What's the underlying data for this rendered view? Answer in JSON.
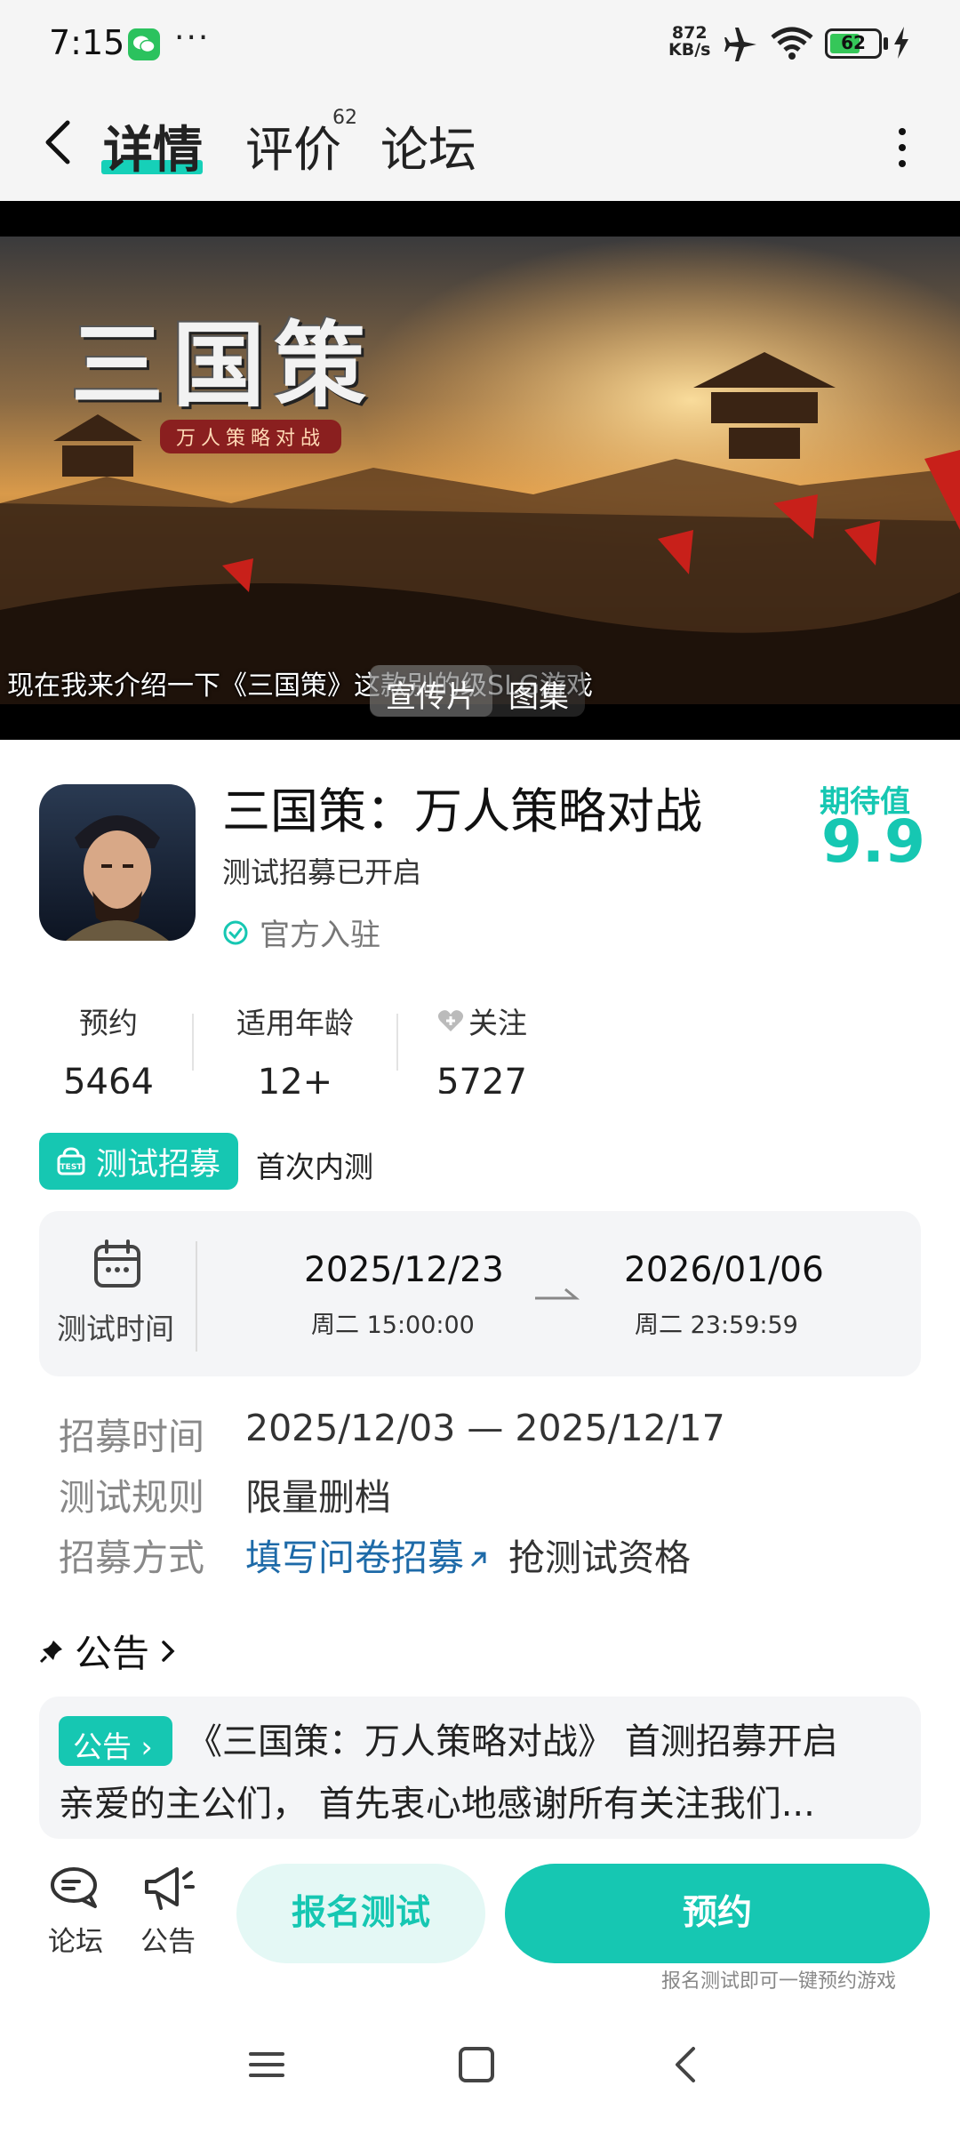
{
  "status_bar": {
    "time": "7:15",
    "net_speed_value": "872",
    "net_speed_unit": "KB/s",
    "battery": "62",
    "icons": [
      "wechat-icon",
      "more-dots-icon",
      "airplane-icon",
      "wifi-icon",
      "battery-icon",
      "charging-icon"
    ]
  },
  "header": {
    "tabs": [
      {
        "label": "详情",
        "active": true
      },
      {
        "label": "评价",
        "count": "62"
      },
      {
        "label": "论坛"
      }
    ]
  },
  "media": {
    "logo_title": "三国策",
    "logo_subtitle": "万人策略对战",
    "caption": "现在我来介绍一下《三国策》这款别的级SLG游戏",
    "switch": [
      {
        "label": "宣传片",
        "active": true
      },
      {
        "label": "图集",
        "active": false
      }
    ]
  },
  "game": {
    "title": "三国策：万人策略对战",
    "subtitle": "测试招募已开启",
    "official": "官方入驻",
    "expect_label": "期待值",
    "expect_score": "9.9"
  },
  "stats": [
    {
      "label": "预约",
      "value": "5464"
    },
    {
      "label": "适用年龄",
      "value": "12+"
    },
    {
      "label": "关注",
      "value": "5727"
    }
  ],
  "test": {
    "badge": "测试招募",
    "type": "首次内测",
    "time_label": "测试时间",
    "start_date": "2025/12/23",
    "start_sub": "周二  15:00:00",
    "end_date": "2026/01/06",
    "end_sub": "周二  23:59:59"
  },
  "details": {
    "recruit_time_label": "招募时间",
    "recruit_time_value": "2025/12/03 — 2025/12/17",
    "rule_label": "测试规则",
    "rule_value": "限量删档",
    "method_label": "招募方式",
    "method_link": "填写问卷招募",
    "method_value": "抢测试资格"
  },
  "announcement": {
    "heading": "公告",
    "tag": "公告",
    "title": "《三国策：万人策略对战》 首测招募开启",
    "body": "亲爱的主公们， 首先衷心地感谢所有关注我们..."
  },
  "action_bar": {
    "forum_label": "论坛",
    "notice_label": "公告",
    "signup_label": "报名测试",
    "reserve_label": "预约",
    "hint": "报名测试即可一键预约游戏"
  },
  "colors": {
    "accent": "#16c7b2",
    "link": "#1d6aa8"
  }
}
